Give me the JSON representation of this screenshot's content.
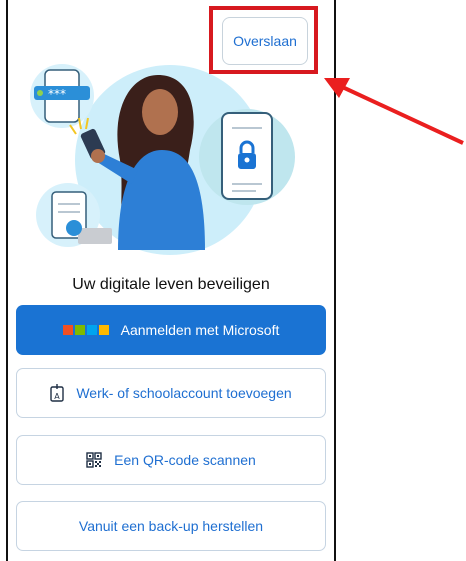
{
  "header": {
    "skip_label": "Overslaan"
  },
  "main": {
    "headline": "Uw digitale leven beveiligen",
    "buttons": {
      "microsoft": "Aanmelden met Microsoft",
      "work": "Werk- of schoolaccount toevoegen",
      "qr": "Een QR-code scannen",
      "restore": "Vanuit een back-up herstellen"
    },
    "illustration": {
      "password_mask": "***"
    }
  },
  "icons": {
    "microsoft": "microsoft-logo-icon",
    "work": "badge-icon",
    "qr": "qr-code-icon"
  },
  "colors": {
    "primary": "#1a73d3",
    "link": "#1f6fd1",
    "highlight": "#d7191f",
    "ms_red": "#f25022",
    "ms_green": "#7fba00",
    "ms_blue": "#00a4ef",
    "ms_yellow": "#ffb900"
  }
}
